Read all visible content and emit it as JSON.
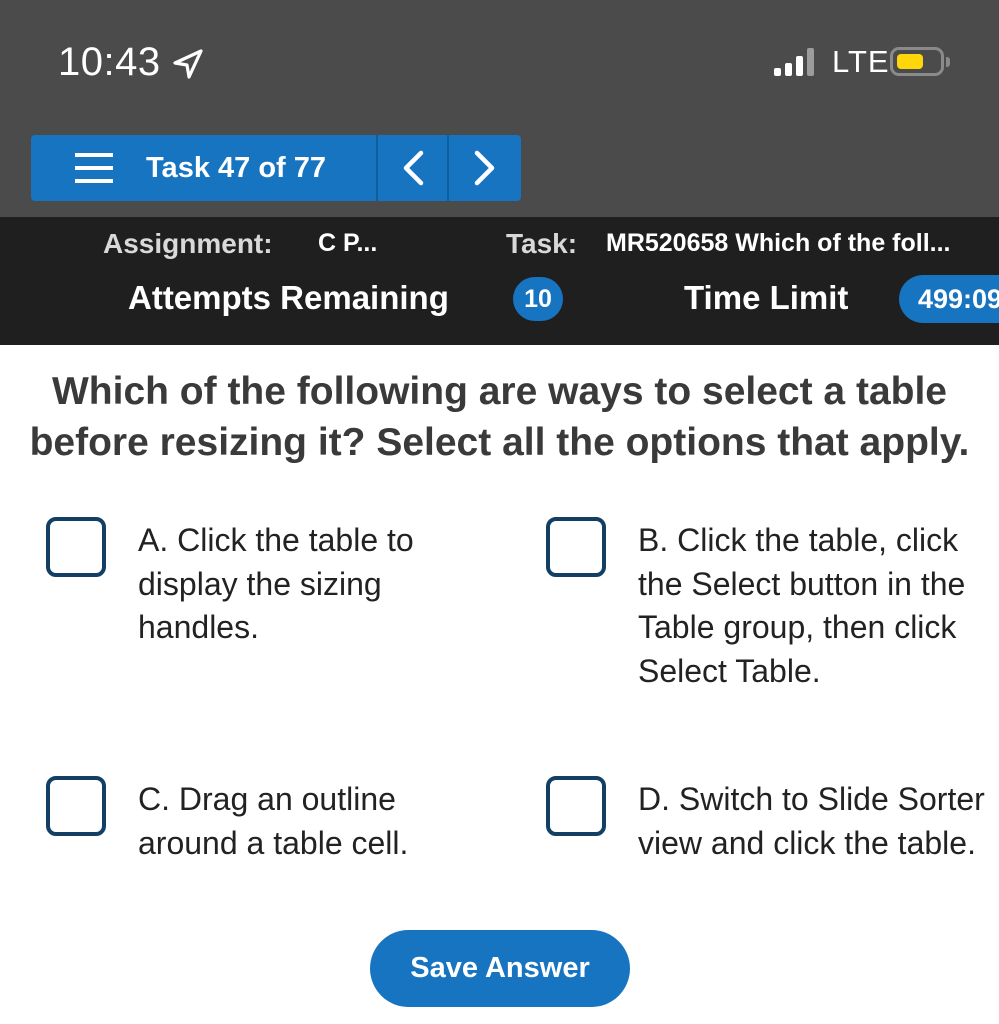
{
  "status_bar": {
    "time": "10:43",
    "network": "LTE",
    "location_icon": "location-arrow-icon",
    "signal_icon": "cellular-signal-icon",
    "battery_icon": "battery-icon",
    "battery_color": "#ffd60a"
  },
  "nav": {
    "task_counter": "Task 47 of 77",
    "menu_icon": "hamburger-menu-icon",
    "prev_icon": "chevron-left-icon",
    "next_icon": "chevron-right-icon"
  },
  "info": {
    "assignment_label": "Assignment:",
    "assignment_value": "C P...",
    "task_label": "Task:",
    "task_value": "MR520658 Which of the foll...",
    "attempts_label": "Attempts Remaining",
    "attempts_value": "10",
    "time_limit_label": "Time Limit",
    "time_limit_value": "499:09"
  },
  "question": {
    "text": "Which of the following are ways to select a table before resizing it? Select all the options that apply."
  },
  "options": [
    {
      "text": "A. Click the table to display the sizing handles.",
      "checked": false
    },
    {
      "text": "B. Click the table, click the Select button in the Table group, then click Select Table.",
      "checked": false
    },
    {
      "text": "C. Drag an outline around a table cell.",
      "checked": false
    },
    {
      "text": "D. Switch to Slide Sorter view and click the table.",
      "checked": false
    }
  ],
  "save_label": "Save Answer",
  "colors": {
    "accent": "#1774c0",
    "header_bg": "#4b4b4b",
    "info_bg": "#1f1f1f",
    "checkbox_border": "#123f63"
  }
}
